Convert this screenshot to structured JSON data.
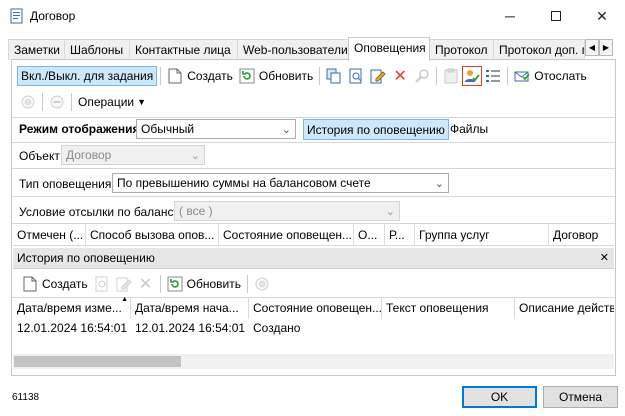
{
  "window": {
    "title": "Договор",
    "minimize_icon": "minimize-icon",
    "maximize_icon": "maximize-icon",
    "close_icon": "close-icon"
  },
  "tabs": [
    "Заметки",
    "Шаблоны",
    "Контактные лица",
    "Web-пользователи",
    "Оповещения",
    "Протокол",
    "Протокол доп. п"
  ],
  "active_tab": "Оповещения",
  "toolbar1": {
    "toggle": "Вкл./Выкл. для задания",
    "create": "Создать",
    "refresh": "Обновить",
    "send": "Отослать"
  },
  "toolbar2": {
    "operations": "Операции"
  },
  "form": {
    "mode_label": "Режим отображения:",
    "mode_value": "Обычный",
    "history_tab": "История по оповещению",
    "files_tab": "Файлы",
    "object_label": "Объект:",
    "object_value": "Договор",
    "type_label": "Тип оповещения:",
    "type_value": "По превышению суммы на балансовом счете",
    "condition_label": "Условие отсылки по балансу:",
    "condition_value": "( все )"
  },
  "main_grid": {
    "columns": [
      "Отмечен (...",
      "Способ вызова опов...",
      "Состояние оповещен...",
      "О...",
      "Р...",
      "Группа услуг",
      "Договор"
    ]
  },
  "history": {
    "title": "История по оповещению",
    "create": "Создать",
    "refresh": "Обновить",
    "columns": [
      "Дата/время изме...",
      "Дата/время нача...",
      "Состояние оповещен...",
      "Текст оповещения",
      "Описание действи"
    ],
    "rows": [
      [
        "12.01.2024 16:54:01",
        "12.01.2024 16:54:01",
        "Создано",
        "",
        ""
      ]
    ]
  },
  "status": {
    "code": "61138"
  },
  "buttons": {
    "ok": "OK",
    "cancel": "Отмена"
  },
  "colors": {
    "accent": "#0078d7",
    "pressed": "#cde8fb",
    "danger": "#e33b2e"
  }
}
